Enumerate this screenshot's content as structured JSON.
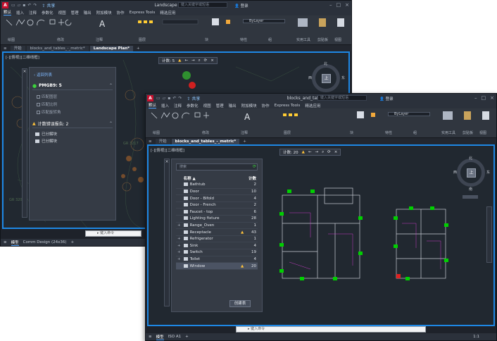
{
  "window_back": {
    "title": "Landscape Plan.dwg",
    "share_label": "共享",
    "search_placeholder": "键入关键字或短语",
    "login_label": "登录",
    "menus": [
      "默认",
      "插入",
      "注释",
      "参数化",
      "视图",
      "管理",
      "输出",
      "附加模块",
      "协作",
      "Express Tools",
      "精选应用"
    ],
    "ribbon": {
      "groups": [
        "绘图",
        "修改",
        "注释",
        "图层",
        "块",
        "特性",
        "组",
        "实用工具",
        "剪贴板",
        "视图"
      ],
      "layer_value": "ByLayer",
      "tools": [
        "直线",
        "多段线",
        "圆",
        "圆弧",
        "文字",
        "标注",
        "插入",
        "特性匹配",
        "实用工具",
        "剪贴板",
        "基点"
      ]
    },
    "tabs": [
      "开始",
      "blocks_and_tables_-_metric*",
      "Landscape Plan*"
    ],
    "viewport_label": "[-][俯视][二维线框]",
    "count_toolbar": {
      "label": "计数: 5"
    },
    "panel": {
      "back_label": "返回列表",
      "block_name": "PMGB9: 5",
      "options": [
        "匹配图层",
        "匹配比例",
        "匹配旋转角"
      ],
      "issues_title": "计数错误报告: 2",
      "issues": [
        "已分解块",
        "已分解块"
      ]
    },
    "status_tabs": [
      "模型",
      "Comm Design (24x36)"
    ],
    "cmd_placeholder": "键入命令"
  },
  "window_front": {
    "title": "blocks_and_tables_-_metric.dwg",
    "share_label": "共享",
    "search_placeholder": "键入关键字或短语",
    "login_label": "登录",
    "menus": [
      "默认",
      "插入",
      "注释",
      "参数化",
      "视图",
      "管理",
      "输出",
      "附加模块",
      "协作",
      "Express Tools",
      "精选应用"
    ],
    "ribbon": {
      "groups": [
        "绘图",
        "修改",
        "注释",
        "图层",
        "块",
        "特性",
        "组",
        "实用工具",
        "剪贴板",
        "视图"
      ],
      "layer_value": "ByLayer"
    },
    "tabs": [
      "开始",
      "blocks_and_tables_-_metric*"
    ],
    "viewport_label": "[-][俯视][二维线框]",
    "count_toolbar": {
      "label": "计数: 20"
    },
    "panel": {
      "search_placeholder": "搜索",
      "col_name": "名称 ▲",
      "col_count": "计数",
      "rows": [
        {
          "name": "Bathtub",
          "count": "2",
          "warn": false,
          "expand": false
        },
        {
          "name": "Door",
          "count": "10",
          "warn": false,
          "expand": false
        },
        {
          "name": "Door - Bifold",
          "count": "4",
          "warn": false,
          "expand": false
        },
        {
          "name": "Door - French",
          "count": "2",
          "warn": false,
          "expand": false
        },
        {
          "name": "Faucet - top",
          "count": "6",
          "warn": false,
          "expand": false
        },
        {
          "name": "Lighting fixture",
          "count": "28",
          "warn": false,
          "expand": false
        },
        {
          "name": "Range_Oven",
          "count": "1",
          "warn": false,
          "expand": true
        },
        {
          "name": "Receptacle",
          "count": "43",
          "warn": true,
          "expand": false
        },
        {
          "name": "Refrigerator",
          "count": "1",
          "warn": false,
          "expand": true
        },
        {
          "name": "Sink",
          "count": "4",
          "warn": false,
          "expand": true
        },
        {
          "name": "Switch",
          "count": "19",
          "warn": false,
          "expand": true
        },
        {
          "name": "Toilet",
          "count": "4",
          "warn": false,
          "expand": true
        },
        {
          "name": "Window",
          "count": "20",
          "warn": true,
          "expand": false,
          "selected": true
        }
      ],
      "create_table_label": "创建表"
    },
    "status_tabs": [
      "模型",
      "ISO A1"
    ],
    "cmd_placeholder": "键入命令",
    "scale_label": "1:1"
  },
  "compass": {
    "north": "北",
    "south": "南",
    "east": "东",
    "west": "西",
    "top": "上"
  },
  "colors": {
    "accent": "#1e88e5",
    "warning": "#ffc23a",
    "block_green": "#00d000",
    "autocad_red": "#c8102e"
  }
}
